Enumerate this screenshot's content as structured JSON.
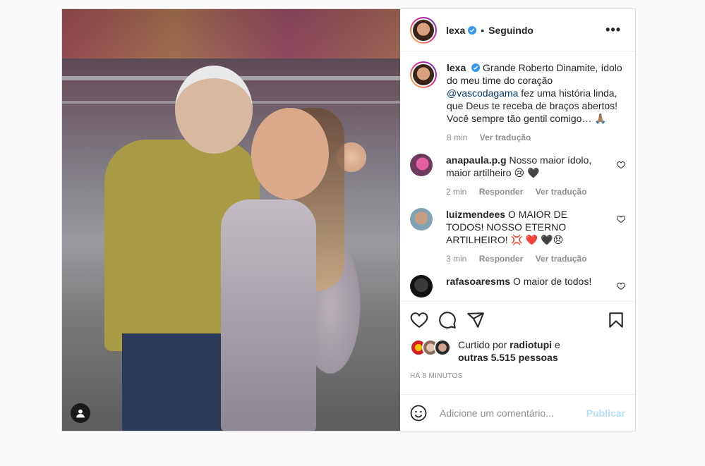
{
  "post": {
    "username": "lexa",
    "separator": "•",
    "follow_status": "Seguindo",
    "more_label": "•••"
  },
  "caption": {
    "username": "lexa",
    "text_before_mention": "Grande Roberto Dinamite, ídolo do meu time do coração",
    "mention": "@vascodagama",
    "text_after_mention": "fez uma história linda, que Deus te receba de braços abertos! Você sempre tão gentil comigo… 🙏🏽",
    "time": "8 min",
    "translate": "Ver tradução"
  },
  "comments": [
    {
      "username": "anapaula.p.g",
      "text": "Nosso maior ídolo, maior artilheiro 😢 🖤",
      "time": "2 min",
      "reply": "Responder",
      "translate": "Ver tradução"
    },
    {
      "username": "luizmendees",
      "text": "O MAIOR DE TODOS! NOSSO ETERNO ARTILHEIRO! 💢 ❤️ 🖤😞",
      "time": "3 min",
      "reply": "Responder",
      "translate": "Ver tradução"
    },
    {
      "username": "rafasoaresms",
      "text": "O maior de todos!"
    }
  ],
  "likes": {
    "prefix": "Curtido por",
    "user": "radiotupi",
    "connector": "e",
    "others": "outras 5.515 pessoas"
  },
  "time_ago": "HÁ 8 MINUTOS",
  "add_comment": {
    "placeholder": "Adicione um comentário...",
    "publish_label": "Publicar"
  },
  "colors": {
    "verified": "#3897f0",
    "link": "#00376b",
    "publish_disabled": "#b2dffc",
    "muted": "#8e8e8e"
  },
  "icons": [
    "heart-icon",
    "comment-icon",
    "share-icon",
    "bookmark-icon",
    "emoji-icon",
    "user-tag-icon",
    "verified-badge-icon",
    "more-options-icon"
  ]
}
